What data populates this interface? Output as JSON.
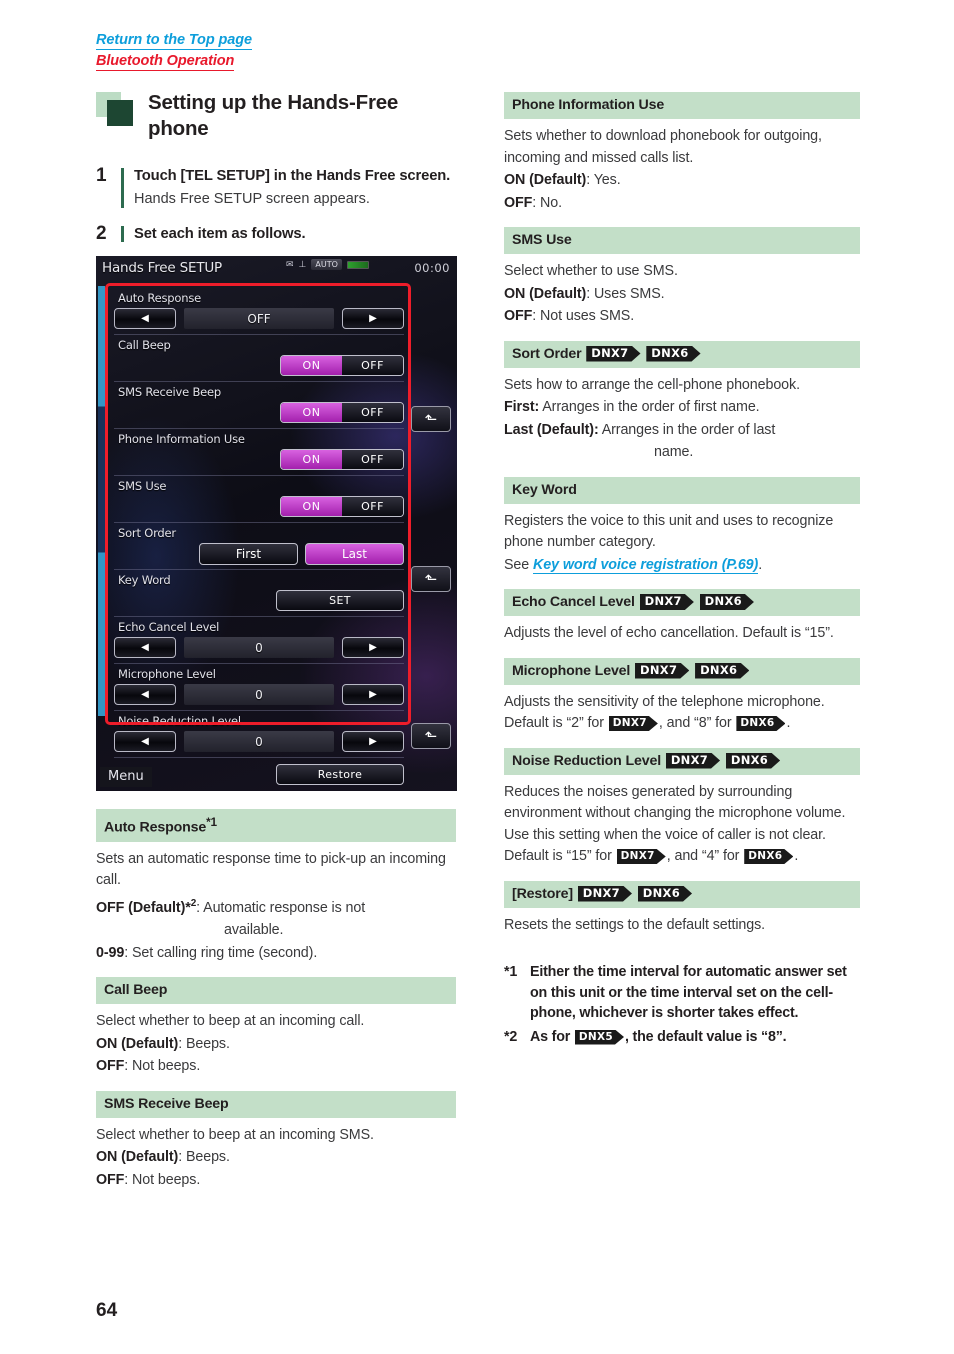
{
  "top_links": [
    {
      "label": "Return to the Top page",
      "color": "#0d9edb"
    },
    {
      "label": "Bluetooth Operation",
      "color": "#e8192c"
    }
  ],
  "heading": "Setting up the Hands-Free phone",
  "steps": [
    {
      "number": "1",
      "title": "Touch [TEL SETUP] in the Hands Free screen.",
      "sub": "Hands Free SETUP screen appears."
    },
    {
      "number": "2",
      "title": "Set each item as follows.",
      "sub": ""
    }
  ],
  "device_screen": {
    "title": "Hands Free SETUP",
    "time": "00:00",
    "status_auto": "AUTO",
    "menu_label": "Menu",
    "rows": [
      {
        "label": "Auto Response",
        "type": "stepper",
        "value": "OFF"
      },
      {
        "label": "Call Beep",
        "type": "toggle",
        "on": "ON",
        "off": "OFF",
        "selected": "ON"
      },
      {
        "label": "SMS Receive Beep",
        "type": "toggle",
        "on": "ON",
        "off": "OFF",
        "selected": "ON"
      },
      {
        "label": "Phone Information Use",
        "type": "toggle",
        "on": "ON",
        "off": "OFF",
        "selected": "ON"
      },
      {
        "label": "SMS Use",
        "type": "toggle",
        "on": "ON",
        "off": "OFF",
        "selected": "ON"
      },
      {
        "label": "Sort Order",
        "type": "pair",
        "first": "First",
        "last": "Last",
        "selected": "Last"
      },
      {
        "label": "Key Word",
        "type": "button",
        "button": "SET"
      },
      {
        "label": "Echo Cancel Level",
        "type": "stepper",
        "value": "0"
      },
      {
        "label": "Microphone Level",
        "type": "stepper",
        "value": "0"
      },
      {
        "label": "Noise Reduction Level",
        "type": "stepper",
        "value": "0"
      },
      {
        "label": "",
        "type": "button",
        "button": "Restore"
      }
    ],
    "back_icon": "back-arrow-icon",
    "left_arrow": "◀",
    "right_arrow": "▶",
    "back_glyph": "⬑"
  },
  "left_sections": [
    {
      "id": "auto-response",
      "title": "Auto Response",
      "title_sup": "*1",
      "badges": [],
      "lines": [
        {
          "text": "Sets an automatic response time to pick-up an incoming call."
        },
        {
          "bold": "OFF (Default)*2",
          "text": ": Automatic response is not"
        },
        {
          "hang": "available."
        },
        {
          "bold": "0-99",
          "text": ": Set calling ring time (second)."
        }
      ]
    },
    {
      "id": "call-beep",
      "title": "Call Beep",
      "badges": [],
      "lines": [
        {
          "text": "Select whether to beep at an incoming call."
        },
        {
          "bold": "ON (Default)",
          "text": ": Beeps."
        },
        {
          "bold": "OFF",
          "text": ": Not beeps."
        }
      ]
    },
    {
      "id": "sms-receive-beep",
      "title": "SMS Receive Beep",
      "badges": [],
      "lines": [
        {
          "text": "Select whether to beep at an incoming SMS."
        },
        {
          "bold": "ON (Default)",
          "text": ": Beeps."
        },
        {
          "bold": "OFF",
          "text": ": Not beeps."
        }
      ]
    }
  ],
  "right_sections": [
    {
      "id": "phone-information-use",
      "title": "Phone Information Use",
      "badges": [],
      "lines": [
        {
          "text": "Sets whether to download phonebook for outgoing, incoming and missed calls list."
        },
        {
          "bold": "ON (Default)",
          "text": ": Yes."
        },
        {
          "bold": "OFF",
          "text": ": No."
        }
      ]
    },
    {
      "id": "sms-use",
      "title": "SMS Use",
      "badges": [],
      "lines": [
        {
          "text": "Select whether to use SMS."
        },
        {
          "bold": "ON (Default)",
          "text": ": Uses SMS."
        },
        {
          "bold": "OFF",
          "text": ": Not uses SMS."
        }
      ]
    },
    {
      "id": "sort-order",
      "title": "Sort Order",
      "badges": [
        "DNX7",
        "DNX6"
      ],
      "lines": [
        {
          "text": "Sets how to arrange the cell-phone phonebook."
        },
        {
          "bold": "First:",
          "text": " Arranges in the order of first name."
        },
        {
          "bold": "Last (Default):",
          "text": " Arranges in the order of last"
        },
        {
          "hang": "name."
        }
      ]
    },
    {
      "id": "key-word",
      "title": "Key Word",
      "badges": [],
      "lines": [
        {
          "text": "Registers the voice to this unit and uses to recognize phone number category."
        },
        {
          "see_prefix": "See ",
          "link": "Key word voice registration (P.69)",
          "see_suffix": "."
        }
      ]
    },
    {
      "id": "echo-cancel-level",
      "title": "Echo Cancel Level",
      "badges": [
        "DNX7",
        "DNX6"
      ],
      "lines": [
        {
          "text": "Adjusts the level of echo cancellation. Default is “15”."
        }
      ]
    },
    {
      "id": "microphone-level",
      "title": "Microphone Level",
      "badges": [
        "DNX7",
        "DNX6"
      ],
      "lines": [
        {
          "mixed_mic": true
        }
      ]
    },
    {
      "id": "noise-reduction-level",
      "title": "Noise Reduction Level",
      "badges": [
        "DNX7",
        "DNX6"
      ],
      "lines": [
        {
          "mixed_noise": true
        }
      ]
    },
    {
      "id": "restore",
      "title": "[Restore]",
      "badges": [
        "DNX7",
        "DNX6"
      ],
      "lines": [
        {
          "text": "Resets the settings to the default settings."
        }
      ]
    }
  ],
  "microphone_body": {
    "part1": "Adjusts the sensitivity of the telephone microphone. Default is “2” for ",
    "badge1": "DNX7",
    "part2": ", and “8” for ",
    "badge2": "DNX6",
    "part3": "."
  },
  "noise_body": {
    "part1": "Reduces the noises generated by surrounding environment without changing the microphone volume. Use this setting when the voice of caller is not clear. Default is “15” for ",
    "badge1": "DNX7",
    "part2": ", and “4” for ",
    "badge2": "DNX6",
    "part3": "."
  },
  "footnotes": [
    {
      "mark": "*1",
      "text": "Either the time interval for automatic answer set on this unit or the time interval set on the cell-phone, whichever is shorter takes effect."
    },
    {
      "mark": "*2",
      "prefix": "As for ",
      "badge": "DNX5",
      "suffix": ", the default value is “8”."
    }
  ],
  "page_number": "64"
}
